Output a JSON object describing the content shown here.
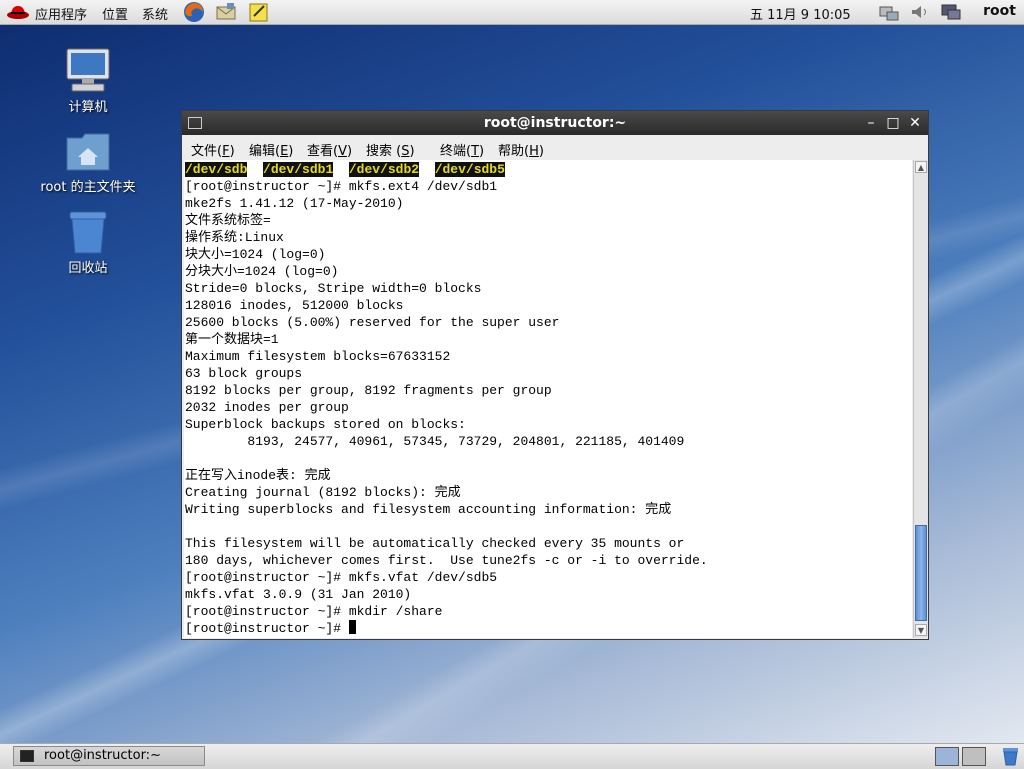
{
  "top_panel": {
    "applications": "应用程序",
    "places": "位置",
    "system": "系统",
    "clock": "五 11月  9 10:05",
    "user": "root",
    "launchers": [
      "firefox-icon",
      "mail-icon",
      "notes-icon"
    ],
    "tray": [
      "network-icon",
      "volume-icon",
      "display-icon"
    ]
  },
  "desktop": {
    "icons": [
      {
        "label": "计算机",
        "icon": "computer-icon"
      },
      {
        "label": "root 的主文件夹",
        "icon": "home-folder-icon"
      },
      {
        "label": "回收站",
        "icon": "trash-icon"
      }
    ]
  },
  "window": {
    "title": "root@instructor:~",
    "menu": [
      {
        "label": "文件(",
        "key": "F",
        "suffix": ")"
      },
      {
        "label": "编辑(",
        "key": "E",
        "suffix": ")"
      },
      {
        "label": "查看(",
        "key": "V",
        "suffix": ")"
      },
      {
        "label": "搜索 (",
        "key": "S",
        "suffix": ")"
      },
      {
        "label": "终端(",
        "key": "T",
        "suffix": ")"
      },
      {
        "label": "帮助(",
        "key": "H",
        "suffix": ")"
      }
    ]
  },
  "terminal": {
    "highlighted_devices": [
      "/dev/sdb",
      "/dev/sdb1",
      "/dev/sdb2",
      "/dev/sdb5"
    ],
    "lines": [
      "[root@instructor ~]# mkfs.ext4 /dev/sdb1",
      "mke2fs 1.41.12 (17-May-2010)",
      "文件系统标签=",
      "操作系统:Linux",
      "块大小=1024 (log=0)",
      "分块大小=1024 (log=0)",
      "Stride=0 blocks, Stripe width=0 blocks",
      "128016 inodes, 512000 blocks",
      "25600 blocks (5.00%) reserved for the super user",
      "第一个数据块=1",
      "Maximum filesystem blocks=67633152",
      "63 block groups",
      "8192 blocks per group, 8192 fragments per group",
      "2032 inodes per group",
      "Superblock backups stored on blocks:",
      "        8193, 24577, 40961, 57345, 73729, 204801, 221185, 401409",
      "",
      "正在写入inode表: 完成",
      "Creating journal (8192 blocks): 完成",
      "Writing superblocks and filesystem accounting information: 完成",
      "",
      "This filesystem will be automatically checked every 35 mounts or",
      "180 days, whichever comes first.  Use tune2fs -c or -i to override.",
      "[root@instructor ~]# mkfs.vfat /dev/sdb5",
      "mkfs.vfat 3.0.9 (31 Jan 2010)",
      "[root@instructor ~]# mkdir /share"
    ],
    "prompt": "[root@instructor ~]# "
  },
  "taskbar": {
    "task_label": "root@instructor:~"
  },
  "colors": {
    "highlight_bg": "#111111",
    "highlight_fg": "#e6db23",
    "titlebar": "#333333",
    "scroll_thumb": "#6f9fdc"
  }
}
